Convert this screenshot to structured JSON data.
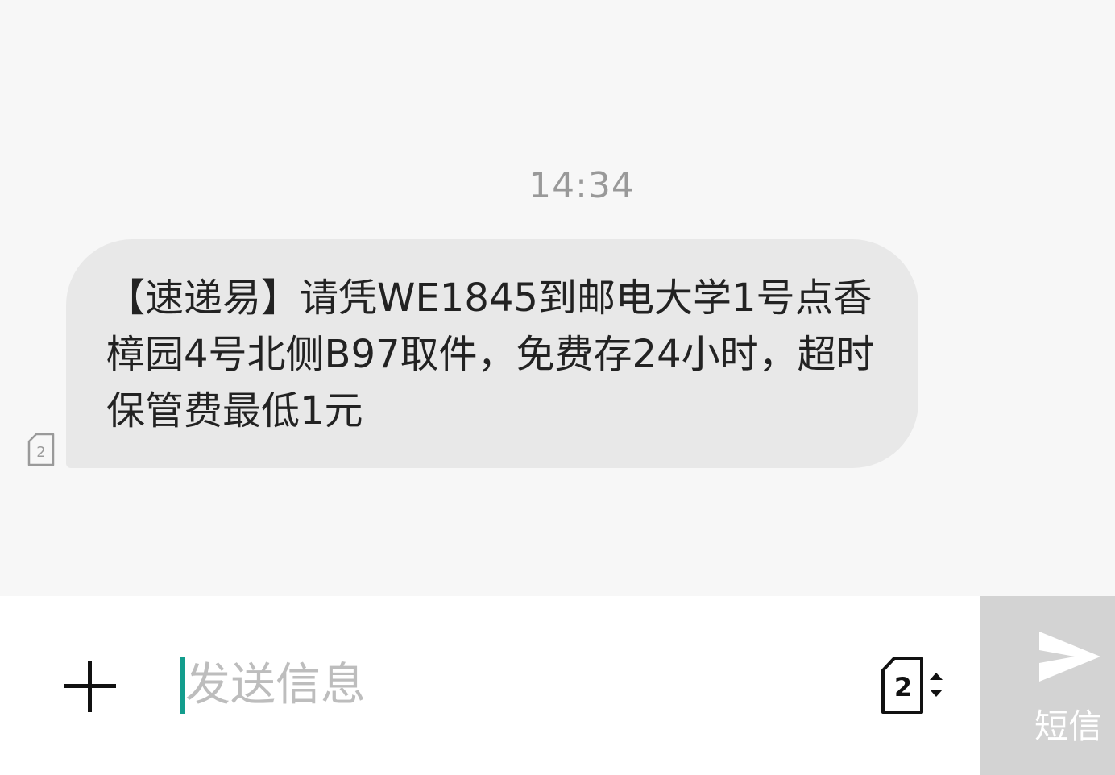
{
  "conversation": {
    "timestamp": "14:34",
    "message": {
      "text": "【速递易】请凭WE1845到邮电大学1号点香樟园4号北侧B97取件，免费存24小时，超时保管费最低1元",
      "sim_slot": "2"
    }
  },
  "composer": {
    "add_icon": "plus-icon",
    "input_placeholder": "发送信息",
    "input_value": "",
    "sim_selector": {
      "slot": "2",
      "icon": "sim-card-icon"
    },
    "send": {
      "label": "短信",
      "icon": "send-arrow-icon",
      "color": "#d3d3d3"
    },
    "cursor_color": "#139d8d"
  }
}
